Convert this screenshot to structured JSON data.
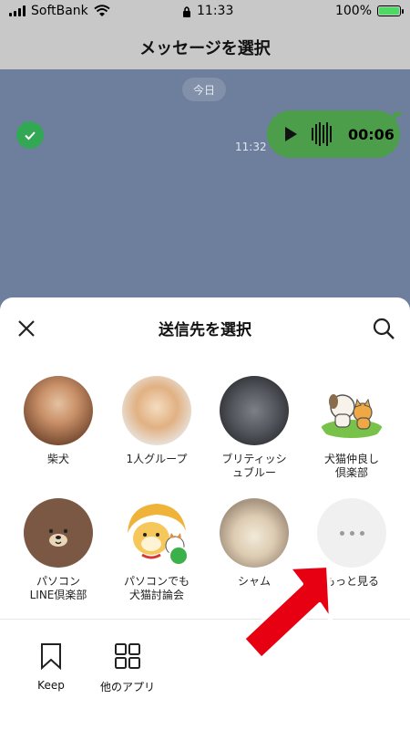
{
  "status_bar": {
    "carrier": "SoftBank",
    "time": "11:33",
    "battery": "100%"
  },
  "header": {
    "title": "メッセージを選択"
  },
  "chat": {
    "date_label": "今日",
    "message": {
      "time": "11:32",
      "duration": "00:06"
    }
  },
  "sheet": {
    "title": "送信先を選択",
    "contacts": [
      {
        "label": "柴犬"
      },
      {
        "label": "1人グループ"
      },
      {
        "label": "ブリティッシ\nュブルー"
      },
      {
        "label": "犬猫仲良し\n倶楽部"
      },
      {
        "label": "パソコン\nLINE倶楽部"
      },
      {
        "label": "パソコンでも\n犬猫討論会"
      },
      {
        "label": "シャム"
      },
      {
        "label": "もっと見る"
      }
    ],
    "bottom": {
      "keep": "Keep",
      "other_apps": "他のアプリ"
    }
  },
  "colors": {
    "accent_green": "#4c9e4a",
    "check_green": "#32a854",
    "arrow_red": "#e60012"
  },
  "icons": [
    "wifi-icon",
    "lock-icon",
    "check-icon",
    "play-icon",
    "close-icon",
    "search-icon",
    "more-icon",
    "bookmark-icon",
    "apps-grid-icon",
    "arrow-icon"
  ]
}
